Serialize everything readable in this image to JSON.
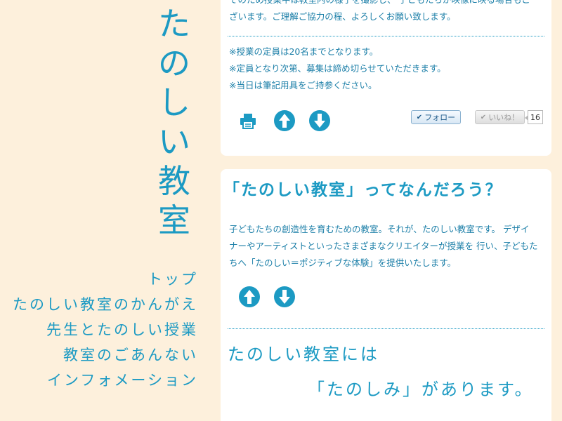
{
  "logo": {
    "chars": [
      "た",
      "の",
      "し",
      "い",
      "教",
      "室"
    ]
  },
  "nav": {
    "items": [
      {
        "label": "トップ"
      },
      {
        "label": "たのしい教室のかんがえ"
      },
      {
        "label": "先生とたのしい授業"
      },
      {
        "label": "教室のごあんない"
      },
      {
        "label": "インフォメーション"
      }
    ]
  },
  "card1": {
    "cut_line1": "そのため授業中は教室内の様子を撮影し、 子どもたちが映像に映る場合もご",
    "cut_line2": "ざいます。ご理解ご協力の程、よろしくお願い致します。",
    "notes": [
      "※授業の定員は20名までとなります。",
      "※定員となり次第、募集は締め切らせていただきます。",
      "※当日は筆記用具をご持参ください。"
    ],
    "follow_label": "フォロー",
    "like_label": "いいね！",
    "like_count": "16"
  },
  "card2": {
    "title": "「たのしい教室」ってなんだろう？",
    "intro_lines": [
      "子どもたちの創造性を育むための教室。それが、たのしい教室です。 デザイ",
      "ナーやアーティストといったさまざまなクリエイターが授業を 行い、子どもた",
      "ちへ「たのしい＝ポジティブな体験」を提供いたします。"
    ],
    "big_line1": "たのしい教室には",
    "big_line2": "「たのしみ」があります。"
  },
  "colors": {
    "accent": "#1c9ac3",
    "background": "#fdf0dc",
    "card": "#ffffff"
  },
  "icons": {
    "print": "print-icon",
    "up": "arrow-up-icon",
    "down": "arrow-down-icon",
    "check": "check-icon"
  }
}
